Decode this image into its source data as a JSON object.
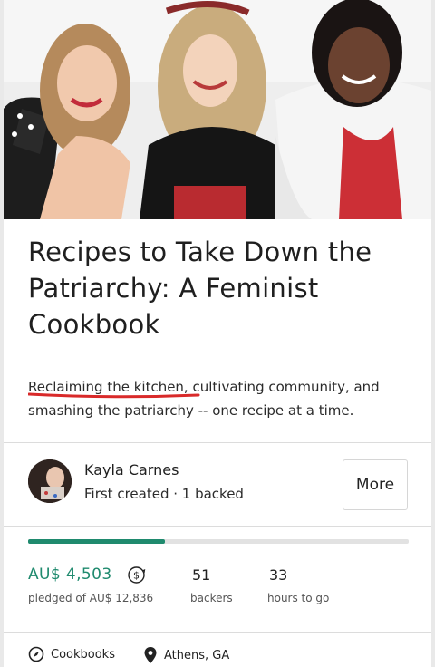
{
  "project": {
    "title": "Recipes to Take Down the Patriarchy: A Feminist Cookbook",
    "blurb": "Reclaiming the kitchen, cultivating community, and smashing the patriarchy -- one recipe at a time."
  },
  "creator": {
    "name": "Kayla Carnes",
    "subtitle": "First created · 1 backed",
    "more_label": "More"
  },
  "funding": {
    "progress_fraction": 0.36,
    "pledged": "AU$ 4,503",
    "pledged_label": "pledged of AU$ 12,836",
    "backers": "51",
    "backers_label": "backers",
    "hours": "33",
    "hours_label": "hours to go"
  },
  "footer": {
    "category": "Cookbooks",
    "location": "Athens, GA"
  },
  "colors": {
    "accent": "#1f8a6e",
    "annotation": "#d92a2a"
  }
}
